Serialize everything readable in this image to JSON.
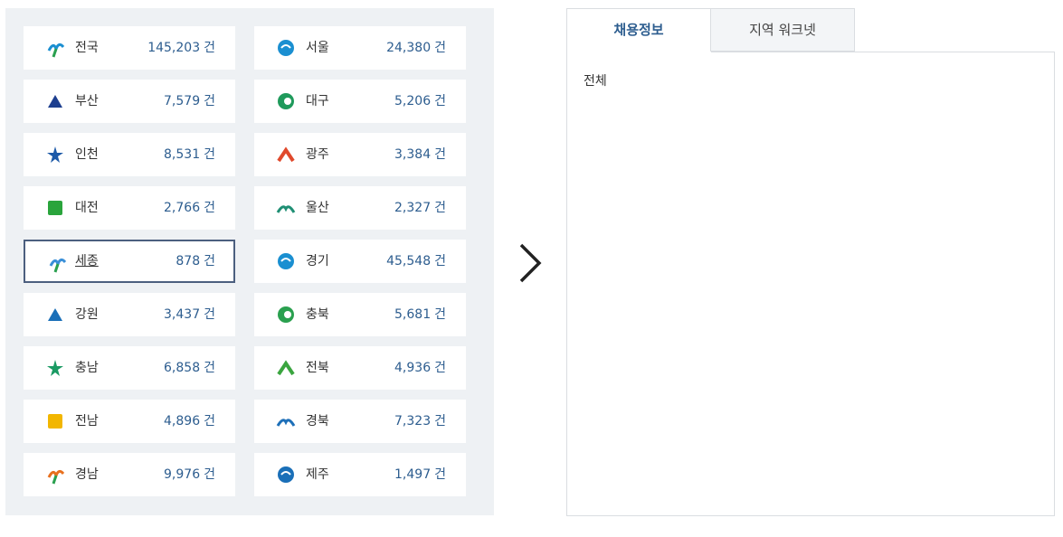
{
  "unit_label": "건",
  "regions": [
    {
      "name": "전국",
      "count": "145,203",
      "icon": "nation-emblem-icon",
      "color": "#1b8fd1"
    },
    {
      "name": "서울",
      "count": "24,380",
      "icon": "seoul-emblem-icon",
      "color": "#1b8fd1"
    },
    {
      "name": "부산",
      "count": "7,579",
      "icon": "busan-emblem-icon",
      "color": "#1d3f8f"
    },
    {
      "name": "대구",
      "count": "5,206",
      "icon": "daegu-emblem-icon",
      "color": "#1f9a5b"
    },
    {
      "name": "인천",
      "count": "8,531",
      "icon": "incheon-emblem-icon",
      "color": "#1d5aa8"
    },
    {
      "name": "광주",
      "count": "3,384",
      "icon": "gwangju-emblem-icon",
      "color": "#e0492c"
    },
    {
      "name": "대전",
      "count": "2,766",
      "icon": "daejeon-emblem-icon",
      "color": "#2aa43c"
    },
    {
      "name": "울산",
      "count": "2,327",
      "icon": "ulsan-emblem-icon",
      "color": "#1f8f74"
    },
    {
      "name": "세종",
      "count": "878",
      "icon": "sejong-emblem-icon",
      "color": "#3a8fd8",
      "selected": true
    },
    {
      "name": "경기",
      "count": "45,548",
      "icon": "gyeonggi-emblem-icon",
      "color": "#1a8fd1"
    },
    {
      "name": "강원",
      "count": "3,437",
      "icon": "gangwon-emblem-icon",
      "color": "#1a6fb8"
    },
    {
      "name": "충북",
      "count": "5,681",
      "icon": "chungbuk-emblem-icon",
      "color": "#2aa04f"
    },
    {
      "name": "충남",
      "count": "6,858",
      "icon": "chungnam-emblem-icon",
      "color": "#1a9a63"
    },
    {
      "name": "전북",
      "count": "4,936",
      "icon": "jeonbuk-emblem-icon",
      "color": "#3aa53f"
    },
    {
      "name": "전남",
      "count": "4,896",
      "icon": "jeonnam-emblem-icon",
      "color": "#f2b600"
    },
    {
      "name": "경북",
      "count": "7,323",
      "icon": "gyeongbuk-emblem-icon",
      "color": "#1d6fb8"
    },
    {
      "name": "경남",
      "count": "9,976",
      "icon": "gyeongnam-emblem-icon",
      "color": "#e8701e"
    },
    {
      "name": "제주",
      "count": "1,497",
      "icon": "jeju-emblem-icon",
      "color": "#1a6fb8"
    }
  ],
  "next_arrow_icon": "chevron-right-icon",
  "tabs": [
    {
      "label": "채용정보",
      "active": true
    },
    {
      "label": "지역 워크넷",
      "active": false
    }
  ],
  "content": {
    "label": "전체"
  },
  "colors": {
    "accent": "#2d5d8f",
    "panel_bg": "#eef1f4",
    "selected_border": "#4c5f7f"
  }
}
